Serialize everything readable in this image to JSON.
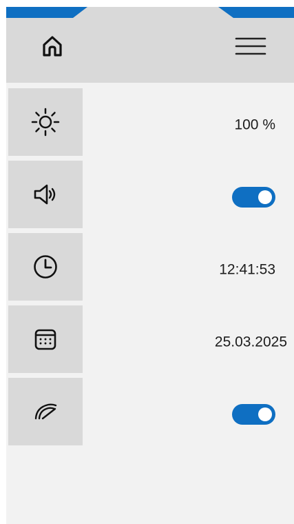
{
  "header": {
    "home_icon": "home-icon",
    "menu_icon": "hamburger-menu-icon"
  },
  "settings": [
    {
      "icon": "brightness-icon",
      "type": "text",
      "value": "100 %"
    },
    {
      "icon": "speaker-icon",
      "type": "toggle",
      "enabled": true
    },
    {
      "icon": "clock-icon",
      "type": "text",
      "value": "12:41:53"
    },
    {
      "icon": "calendar-icon",
      "type": "text",
      "value": "25.03.2025"
    },
    {
      "icon": "speedometer-icon",
      "type": "toggle",
      "enabled": true
    }
  ],
  "colors": {
    "accent": "#0f6fc2",
    "header_background": "#d9d9d9",
    "content_background": "#f2f2f2"
  }
}
